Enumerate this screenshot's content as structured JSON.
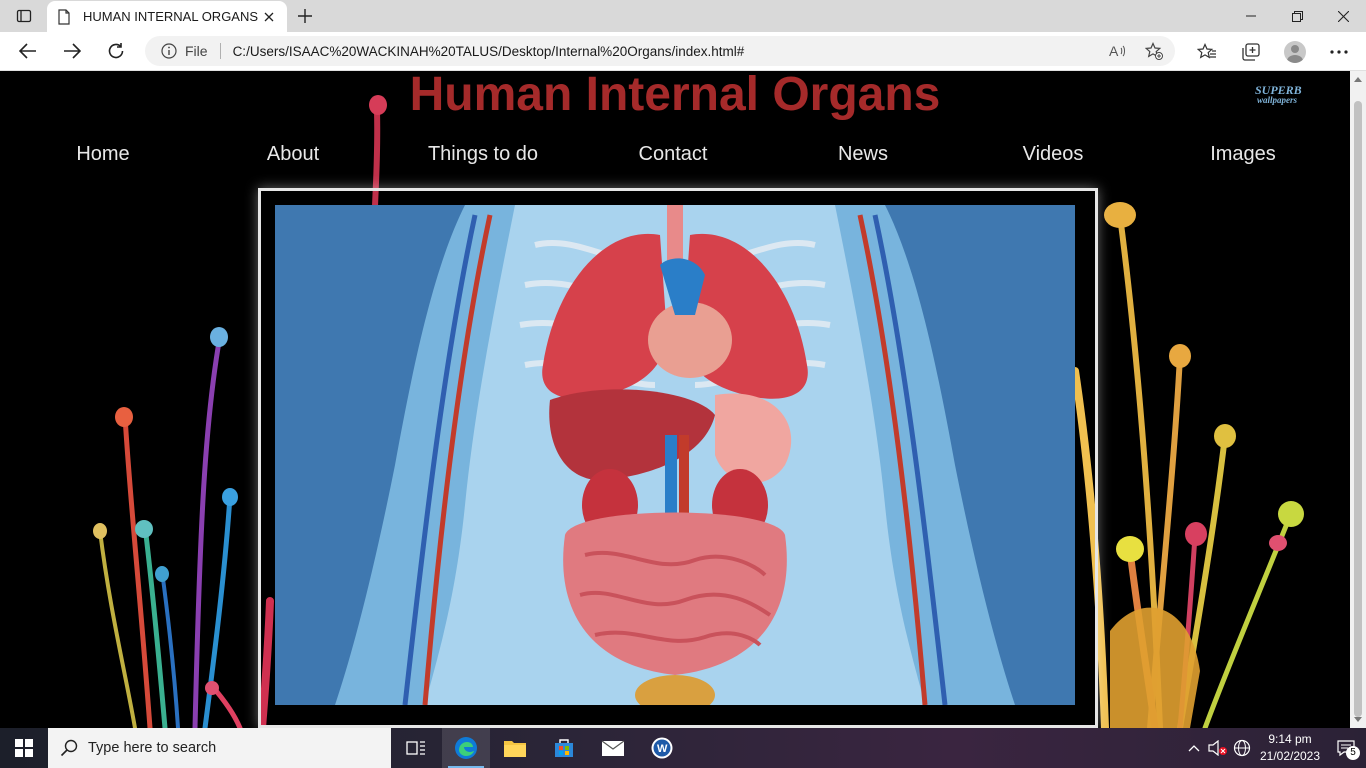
{
  "browser": {
    "tab_title": "HUMAN INTERNAL ORGANS",
    "address_label": "File",
    "url": "C:/Users/ISAAC%20WACKINAH%20TALUS/Desktop/Internal%20Organs/index.html#"
  },
  "page": {
    "title": "Human Internal Organs",
    "title_color": "#a52a2a",
    "logo_line1": "SUPERB",
    "logo_line2": "wallpapers",
    "nav": [
      {
        "label": "Home"
      },
      {
        "label": "About"
      },
      {
        "label": "Things to do"
      },
      {
        "label": "Contact"
      },
      {
        "label": "News"
      },
      {
        "label": "Videos"
      },
      {
        "label": "Images"
      }
    ],
    "hero_image": "human-internal-organs-illustration",
    "background": "black-with-paint-splash-stems"
  },
  "taskbar": {
    "search_placeholder": "Type here to search",
    "time": "9:14 pm",
    "date": "21/02/2023",
    "notification_count": "5"
  },
  "colors": {
    "accent": "#a52a2a",
    "hero_bg": "#3f78b0",
    "edge_blue": "#0f7bd8"
  }
}
